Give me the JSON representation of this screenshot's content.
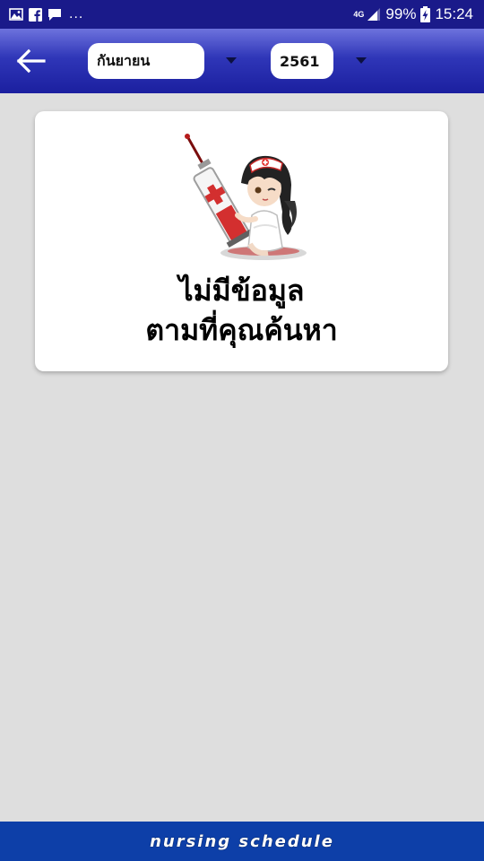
{
  "status_bar": {
    "more_indicator": "...",
    "network_label": "4G",
    "battery_percent": "99%",
    "time": "15:24",
    "left_icons": [
      "image-icon",
      "facebook-icon",
      "message-icon"
    ],
    "right_icons": [
      "signal-icon",
      "battery-charging-icon"
    ]
  },
  "app_bar": {
    "back_icon": "arrow-left-icon",
    "month_select": {
      "value": "กันยายน"
    },
    "year_select": {
      "value": "2561"
    },
    "dropdown_icon": "caret-down-icon"
  },
  "empty_state": {
    "illustration": "nurse-syringe-illustration",
    "line1": "ไม่มีข้อมูล",
    "line2": "ตามที่คุณค้นหา"
  },
  "footer": {
    "brand": "nursing schedule"
  },
  "colors": {
    "status_bar": "#1a1a8a",
    "app_bar_top": "#6d72dd",
    "app_bar_bottom": "#1b1f9f",
    "background": "#dedede",
    "card": "#ffffff",
    "footer": "#0d3fa8"
  }
}
